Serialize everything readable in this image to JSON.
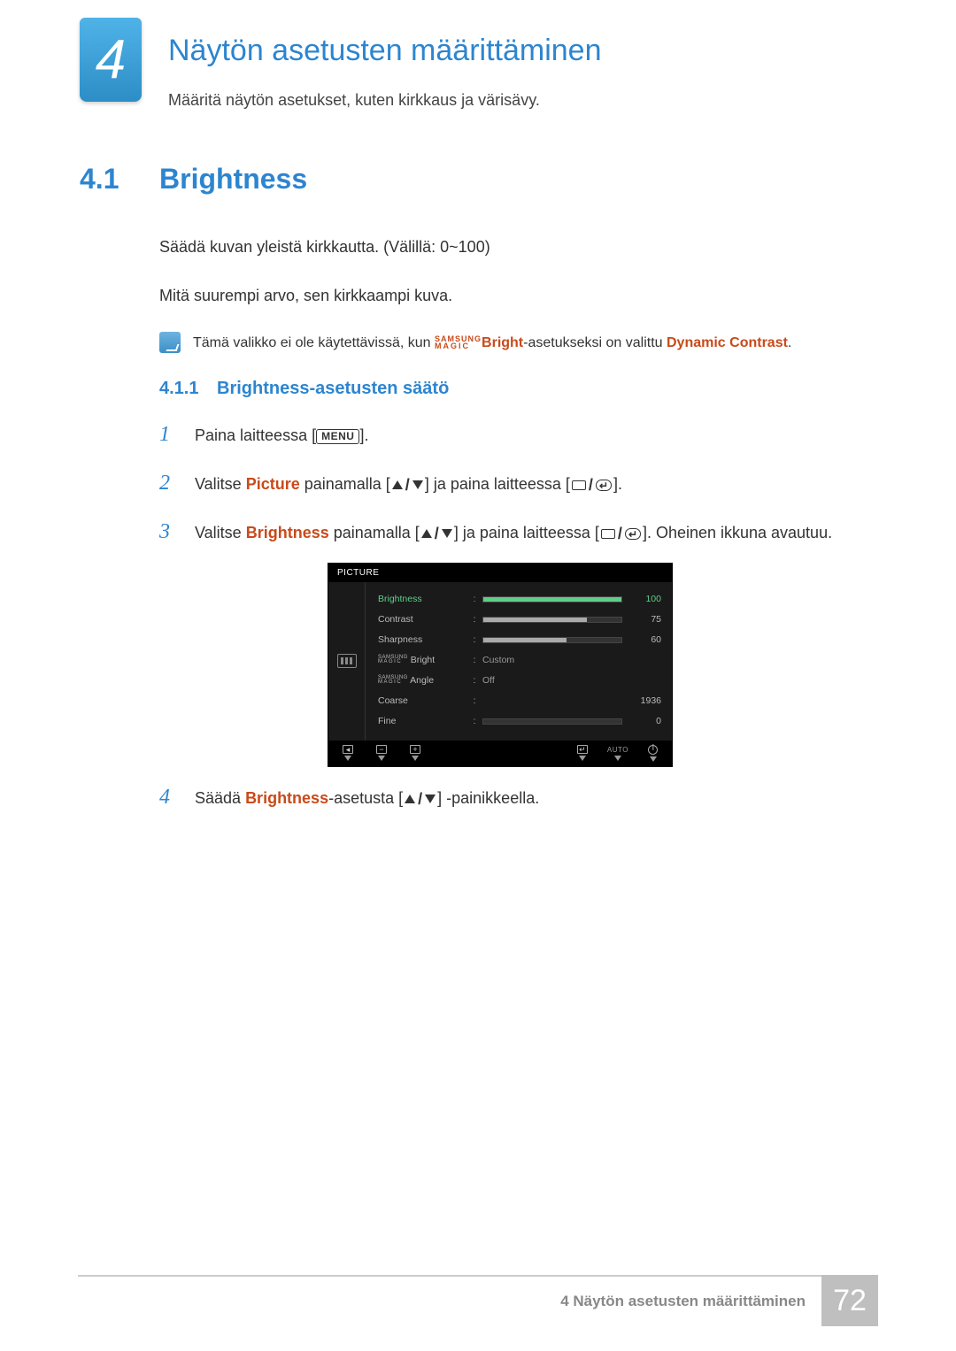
{
  "chapter": {
    "number": "4",
    "title": "Näytön asetusten määrittäminen",
    "desc": "Määritä näytön asetukset, kuten kirkkaus ja värisävy."
  },
  "section": {
    "num": "4.1",
    "title": "Brightness",
    "para1": "Säädä kuvan yleistä kirkkautta. (Välillä: 0~100)",
    "para2": "Mitä suurempi arvo, sen kirkkaampi kuva."
  },
  "note": {
    "pre": "Tämä valikko ei ole käytettävissä, kun ",
    "magic_top": "SAMSUNG",
    "magic_bot": "MAGIC",
    "bright": "Bright",
    "mid": "-asetukseksi on valittu ",
    "dynamic": "Dynamic Contrast",
    "post": "."
  },
  "subsection": {
    "num": "4.1.1",
    "title": "Brightness-asetusten säätö"
  },
  "steps": {
    "s1": {
      "pre": "Paina laitteessa [",
      "menu": "MENU",
      "post": "]."
    },
    "s2": {
      "pre": "Valitse ",
      "picture": "Picture",
      "mid1": " painamalla [",
      "mid2": "] ja paina laitteessa [",
      "post": "]."
    },
    "s3": {
      "pre": "Valitse ",
      "brightness": "Brightness",
      "mid1": " painamalla [",
      "mid2": "] ja paina laitteessa [",
      "post": "]. Oheinen ikkuna avautuu."
    },
    "s4": {
      "pre": "Säädä ",
      "brightness": "Brightness",
      "mid": "-asetusta [",
      "post": "] -painikkeella."
    }
  },
  "osd": {
    "header": "PICTURE",
    "rows": {
      "brightness": {
        "label": "Brightness",
        "value": "100",
        "fill": 100
      },
      "contrast": {
        "label": "Contrast",
        "value": "75",
        "fill": 75
      },
      "sharpness": {
        "label": "Sharpness",
        "value": "60",
        "fill": 60
      },
      "magicbright": {
        "label": " Bright",
        "value": "Custom"
      },
      "magicangle": {
        "label": " Angle",
        "value": "Off"
      },
      "coarse": {
        "label": "Coarse",
        "value": "1936"
      },
      "fine": {
        "label": "Fine",
        "value": "0",
        "fill": 0
      }
    },
    "footer": {
      "auto": "AUTO"
    }
  },
  "footer": {
    "label": "4 Näytön asetusten määrittäminen",
    "page": "72"
  }
}
